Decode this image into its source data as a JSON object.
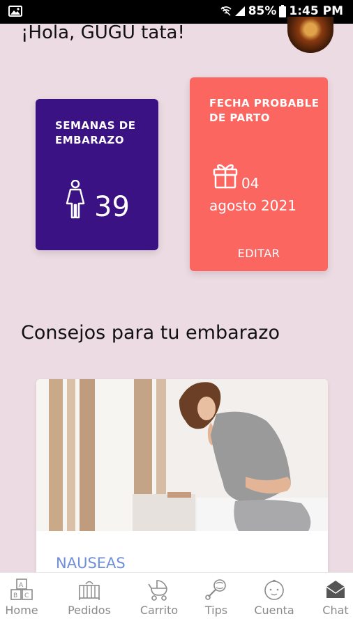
{
  "status_bar": {
    "battery": "85%",
    "time": "1:45 PM"
  },
  "header": {
    "greeting": "¡Hola, GUGU tata!"
  },
  "weeks_card": {
    "label": "SEMANAS DE EMBARAZO",
    "value": "39"
  },
  "due_date_card": {
    "label": "FECHA PROBABLE DE PARTO",
    "day": "04",
    "month_year": "agosto 2021",
    "edit_label": "EDITAR"
  },
  "tips": {
    "section_title": "Consejos para tu embarazo",
    "card_title": "NAUSEAS"
  },
  "colors": {
    "background": "#ecdbe2",
    "weeks_card": "#3b1283",
    "date_card": "#fb6661",
    "tip_title": "#6f8fd9"
  },
  "bottom_nav": {
    "items": [
      {
        "label": "Home",
        "icon": "blocks-icon"
      },
      {
        "label": "Pedidos",
        "icon": "crib-icon"
      },
      {
        "label": "Carrito",
        "icon": "stroller-icon"
      },
      {
        "label": "Tips",
        "icon": "rattle-icon"
      },
      {
        "label": "Cuenta",
        "icon": "baby-face-icon"
      },
      {
        "label": "Chat",
        "icon": "envelope-icon"
      }
    ]
  }
}
